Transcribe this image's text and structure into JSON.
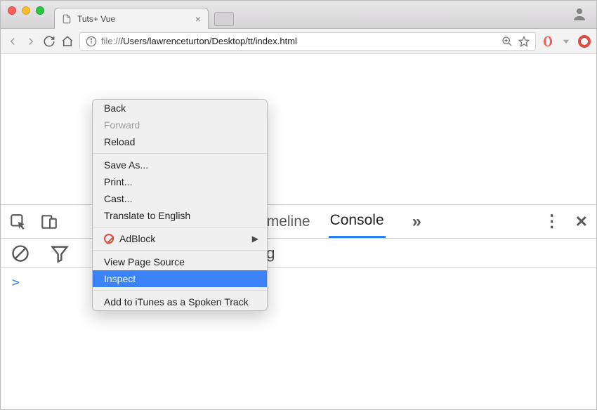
{
  "window": {
    "tab_title": "Tuts+ Vue"
  },
  "url": {
    "protocol": "file://",
    "path": "/Users/lawrenceturton/Desktop/tt/index.html"
  },
  "context_menu": {
    "back": "Back",
    "forward": "Forward",
    "reload": "Reload",
    "save_as": "Save As...",
    "print": "Print...",
    "cast": "Cast...",
    "translate": "Translate to English",
    "adblock": "AdBlock",
    "view_source": "View Page Source",
    "inspect": "Inspect",
    "itunes": "Add to iTunes as a Spoken Track"
  },
  "devtools": {
    "tabs": {
      "timeline": "Timeline",
      "console": "Console"
    },
    "subbar_text": "og",
    "prompt": ">"
  }
}
